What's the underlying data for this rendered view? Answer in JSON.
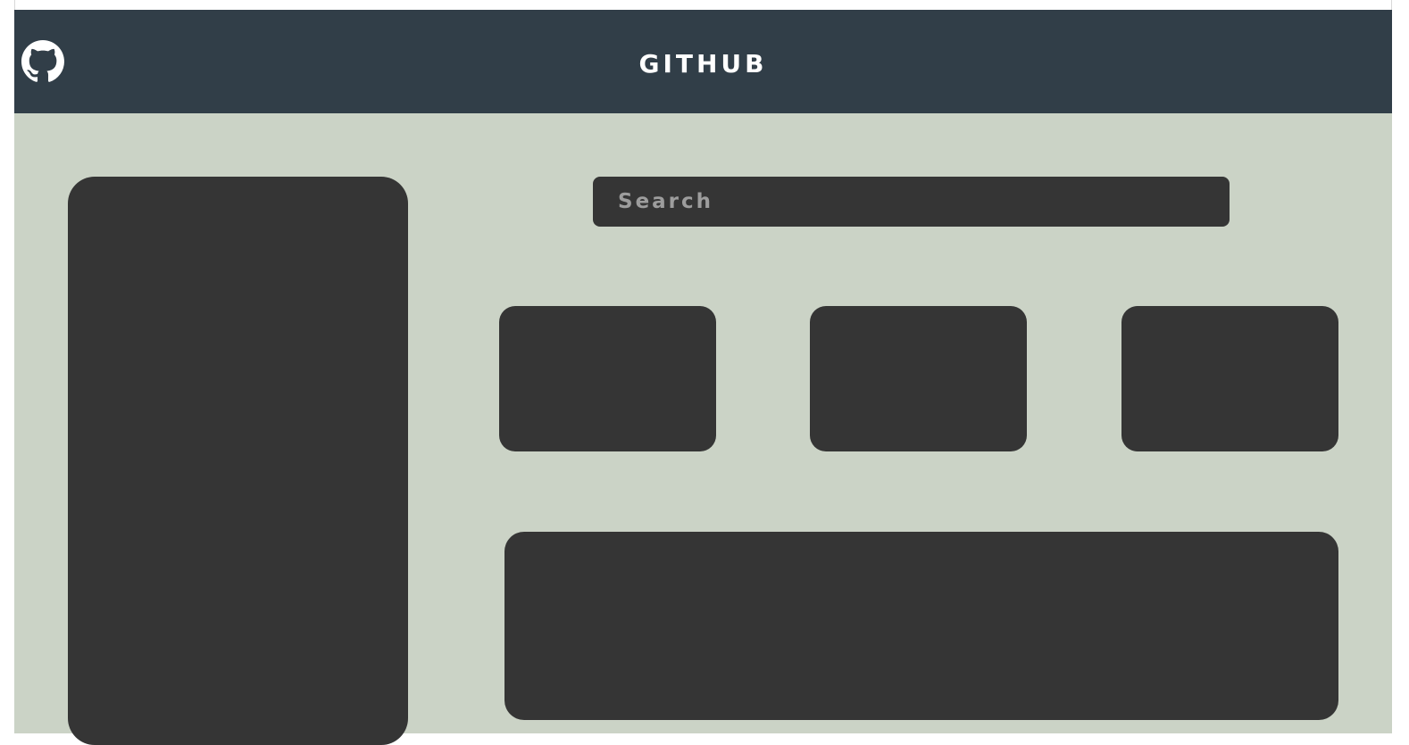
{
  "header": {
    "title": "GITHUB",
    "logo_icon": "github-octocat-icon",
    "background": "#313e48"
  },
  "search": {
    "placeholder": "Search",
    "value": ""
  },
  "colors": {
    "page_background": "#cbd3c6",
    "panel": "#353535",
    "header_text": "#ffffff",
    "placeholder_text": "#9d9d9d"
  }
}
